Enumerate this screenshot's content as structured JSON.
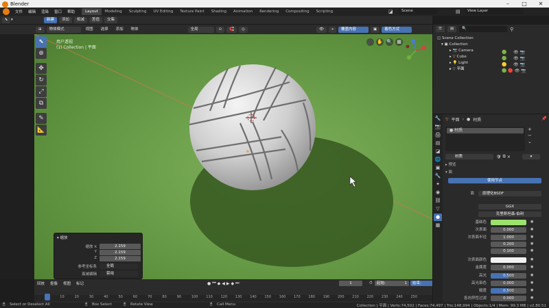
{
  "window": {
    "title": "Blender",
    "min": "–",
    "max": "□",
    "close": "✕"
  },
  "menu": [
    "文件",
    "编辑",
    "渲染",
    "窗口",
    "帮助"
  ],
  "workspaces": [
    "Layout",
    "Modeling",
    "Sculpting",
    "UV Editing",
    "Texture Paint",
    "Shading",
    "Animation",
    "Rendering",
    "Compositing",
    "Scripting"
  ],
  "active_workspace": "Layout",
  "scene": {
    "label": "Scene",
    "view_layer": "View Layer"
  },
  "header": {
    "new": "新建",
    "add": "添加",
    "subtract": "相减",
    "difference": "差值",
    "intersect": "交集"
  },
  "vp_header": {
    "mode": "物体模式",
    "view": "视图",
    "select": "选择",
    "add": "添加",
    "object": "物体",
    "orientation": "全局",
    "overlay_label": "覆盖内容",
    "shading_label": "着色方式"
  },
  "viewport": {
    "persp": "用户透视",
    "collection": "(1) Collection | 平面"
  },
  "op_panel": {
    "title": "缩放",
    "scale_x_label": "缩放 X",
    "scale_x": "2.159",
    "y_label": "Y",
    "scale_y": "2.159",
    "z_label": "Z",
    "scale_z": "2.159",
    "orient_label": "参考坐标系",
    "orient_value": "全局",
    "prop_label": "衰减编辑",
    "prop_value": "禁用"
  },
  "timeline": {
    "playback": "回放",
    "keying": "抠像",
    "view": "视图",
    "marker": "标记",
    "current_frame": "1",
    "start_label": "起始:",
    "start": "1",
    "end_label": "结束:",
    "end": "250",
    "ticks": [
      "0",
      "10",
      "20",
      "30",
      "40",
      "50",
      "60",
      "70",
      "80",
      "90",
      "100",
      "110",
      "120",
      "130",
      "140",
      "150",
      "160",
      "170",
      "180",
      "190",
      "200",
      "210",
      "220",
      "230",
      "240",
      "250"
    ]
  },
  "statusbar": {
    "select": "Select or Deselect All",
    "box": "Box Select",
    "rotate": "Rotate View",
    "menu": "Call Menu",
    "stats": "Collection | 平面 | Verts:74,502 | Faces:74,497 | Tris:148,994 | Objects:1/4 | Mem: 99.3 MB | v2.80.51"
  },
  "outliner": {
    "root": "Scene Collection",
    "collection": "Collection",
    "items": [
      "Camera",
      "Cube",
      "Light",
      "平面"
    ]
  },
  "properties": {
    "breadcrumb_obj": "平面",
    "breadcrumb_mat": "材质",
    "slot": "材质",
    "material_name": "材质",
    "preview_label": "预览",
    "surface_label": "面",
    "use_nodes": "使用节点",
    "surface_field_label": "面",
    "surface_value": "原理化BSDF",
    "distribution": "GGX",
    "subsurface_method": "克里斯坦森-伯利",
    "params": [
      {
        "label": "基础色",
        "value": ""
      },
      {
        "label": "次表面",
        "value": "0.000"
      },
      {
        "label": "次表面半径",
        "value": "1.000"
      },
      {
        "label": "",
        "value": "0.200"
      },
      {
        "label": "",
        "value": "0.100"
      },
      {
        "label": "次表面颜色",
        "value": ""
      },
      {
        "label": "金属度",
        "value": "0.000"
      },
      {
        "label": "高光",
        "value": "0.500"
      },
      {
        "label": "高光染色",
        "value": "0.000"
      },
      {
        "label": "糙度",
        "value": "0.500"
      },
      {
        "label": "各向异性过滤",
        "value": "0.000"
      }
    ]
  },
  "colors": {
    "accent": "#4772b3",
    "base_color": "#9be36d",
    "ground": "#6ea14c"
  }
}
